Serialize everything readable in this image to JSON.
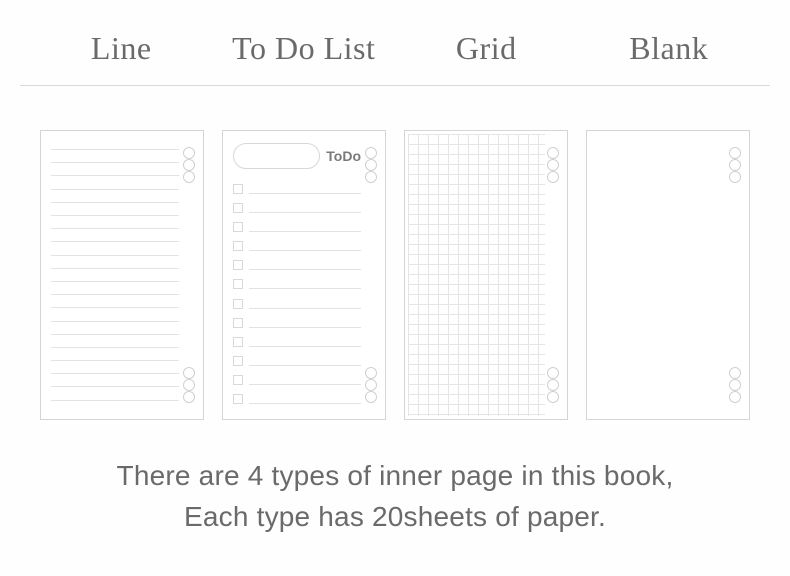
{
  "headers": {
    "line": "Line",
    "todo": "To Do List",
    "grid": "Grid",
    "blank": "Blank"
  },
  "todo_label": "ToDo",
  "caption_line1": "There are 4 types of inner page in this book,",
  "caption_line2": "Each type has 20sheets of paper."
}
